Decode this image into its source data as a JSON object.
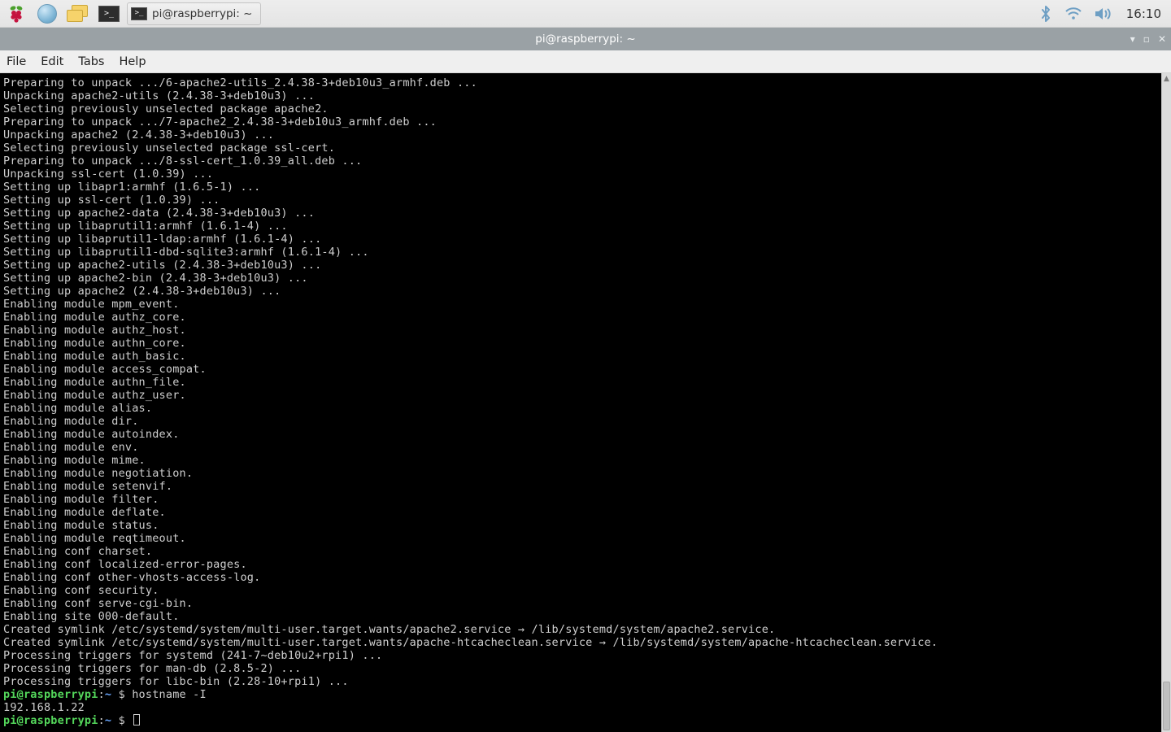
{
  "taskbar": {
    "active_task_label": "pi@raspberrypi: ~",
    "clock": "16:10",
    "launchers": {
      "menu": "raspberry-menu-icon",
      "browser": "globe-icon",
      "files": "file-manager-icon",
      "terminal": "terminal-icon"
    },
    "tray": {
      "bluetooth": "bluetooth-icon",
      "wifi": "wifi-icon",
      "volume": "volume-icon"
    }
  },
  "window": {
    "title": "pi@raspberrypi: ~",
    "buttons": {
      "min": "▾",
      "max": "▫",
      "close": "✕"
    }
  },
  "menubar": {
    "items": [
      "File",
      "Edit",
      "Tabs",
      "Help"
    ]
  },
  "terminal": {
    "lines": [
      "Preparing to unpack .../6-apache2-utils_2.4.38-3+deb10u3_armhf.deb ...",
      "Unpacking apache2-utils (2.4.38-3+deb10u3) ...",
      "Selecting previously unselected package apache2.",
      "Preparing to unpack .../7-apache2_2.4.38-3+deb10u3_armhf.deb ...",
      "Unpacking apache2 (2.4.38-3+deb10u3) ...",
      "Selecting previously unselected package ssl-cert.",
      "Preparing to unpack .../8-ssl-cert_1.0.39_all.deb ...",
      "Unpacking ssl-cert (1.0.39) ...",
      "Setting up libapr1:armhf (1.6.5-1) ...",
      "Setting up ssl-cert (1.0.39) ...",
      "Setting up apache2-data (2.4.38-3+deb10u3) ...",
      "Setting up libaprutil1:armhf (1.6.1-4) ...",
      "Setting up libaprutil1-ldap:armhf (1.6.1-4) ...",
      "Setting up libaprutil1-dbd-sqlite3:armhf (1.6.1-4) ...",
      "Setting up apache2-utils (2.4.38-3+deb10u3) ...",
      "Setting up apache2-bin (2.4.38-3+deb10u3) ...",
      "Setting up apache2 (2.4.38-3+deb10u3) ...",
      "Enabling module mpm_event.",
      "Enabling module authz_core.",
      "Enabling module authz_host.",
      "Enabling module authn_core.",
      "Enabling module auth_basic.",
      "Enabling module access_compat.",
      "Enabling module authn_file.",
      "Enabling module authz_user.",
      "Enabling module alias.",
      "Enabling module dir.",
      "Enabling module autoindex.",
      "Enabling module env.",
      "Enabling module mime.",
      "Enabling module negotiation.",
      "Enabling module setenvif.",
      "Enabling module filter.",
      "Enabling module deflate.",
      "Enabling module status.",
      "Enabling module reqtimeout.",
      "Enabling conf charset.",
      "Enabling conf localized-error-pages.",
      "Enabling conf other-vhosts-access-log.",
      "Enabling conf security.",
      "Enabling conf serve-cgi-bin.",
      "Enabling site 000-default.",
      "Created symlink /etc/systemd/system/multi-user.target.wants/apache2.service → /lib/systemd/system/apache2.service.",
      "Created symlink /etc/systemd/system/multi-user.target.wants/apache-htcacheclean.service → /lib/systemd/system/apache-htcacheclean.service.",
      "Processing triggers for systemd (241-7~deb10u2+rpi1) ...",
      "Processing triggers for man-db (2.8.5-2) ...",
      "Processing triggers for libc-bin (2.28-10+rpi1) ..."
    ],
    "prompt1": {
      "user_host": "pi@raspberrypi",
      "sep": ":",
      "path": "~",
      "dollar": " $ ",
      "command": "hostname -I"
    },
    "output1": "192.168.1.22",
    "prompt2": {
      "user_host": "pi@raspberrypi",
      "sep": ":",
      "path": "~",
      "dollar": " $ "
    }
  }
}
